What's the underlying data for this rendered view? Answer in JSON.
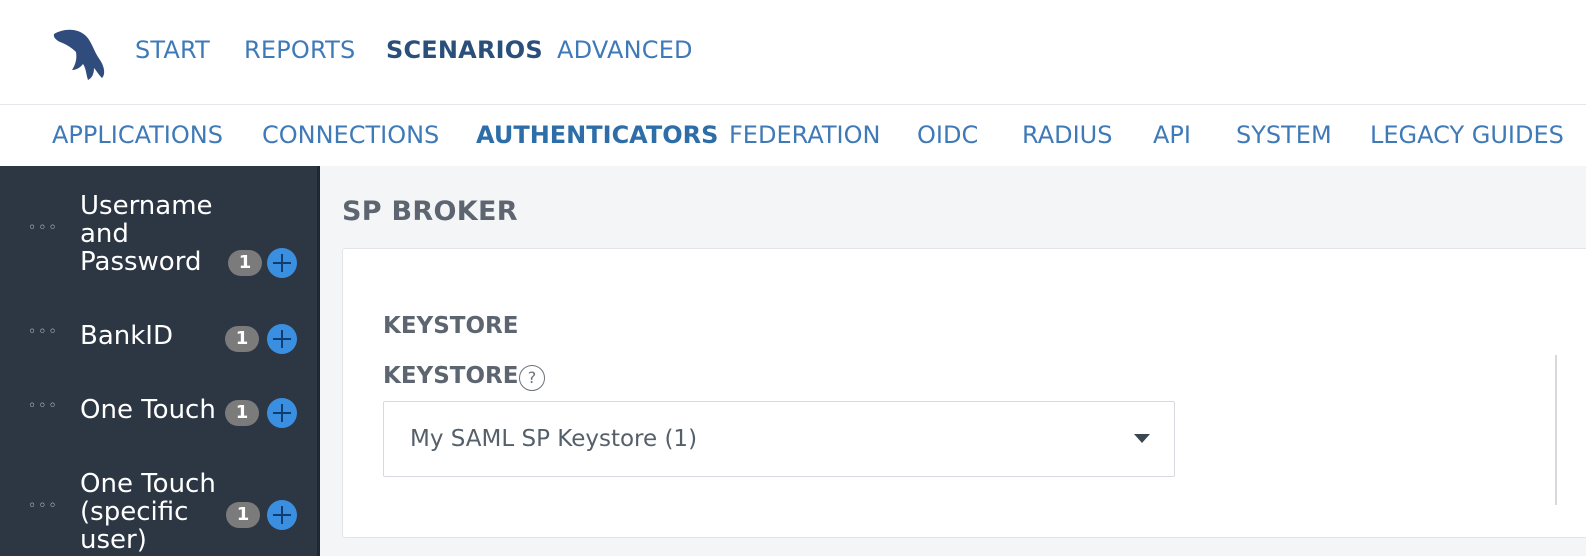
{
  "topnav": {
    "items": [
      {
        "label": "START"
      },
      {
        "label": "REPORTS"
      },
      {
        "label": "SCENARIOS"
      },
      {
        "label": "ADVANCED"
      }
    ],
    "active": "SCENARIOS"
  },
  "subnav": {
    "items": [
      {
        "label": "APPLICATIONS"
      },
      {
        "label": "CONNECTIONS"
      },
      {
        "label": "AUTHENTICATORS"
      },
      {
        "label": "FEDERATION"
      },
      {
        "label": "OIDC"
      },
      {
        "label": "RADIUS"
      },
      {
        "label": "API"
      },
      {
        "label": "SYSTEM"
      },
      {
        "label": "LEGACY GUIDES"
      }
    ],
    "active": "AUTHENTICATORS"
  },
  "sidebar": {
    "items": [
      {
        "label": "Username\nand\nPassword",
        "count": "1"
      },
      {
        "label": "BankID",
        "count": "1"
      },
      {
        "label": "One Touch",
        "count": "1"
      },
      {
        "label": "One Touch\n(specific\nuser)",
        "count": "1"
      }
    ]
  },
  "main": {
    "title": "SP BROKER",
    "section_title": "KEYSTORE",
    "field_label": "KEYSTORE",
    "help_glyph": "?",
    "select_value": "My SAML SP Keystore (1)"
  },
  "colors": {
    "accent": "#3f7ab8",
    "sidebar_bg": "#2d3744",
    "add_button": "#3b8fe0",
    "badge": "#7b7b7b"
  }
}
